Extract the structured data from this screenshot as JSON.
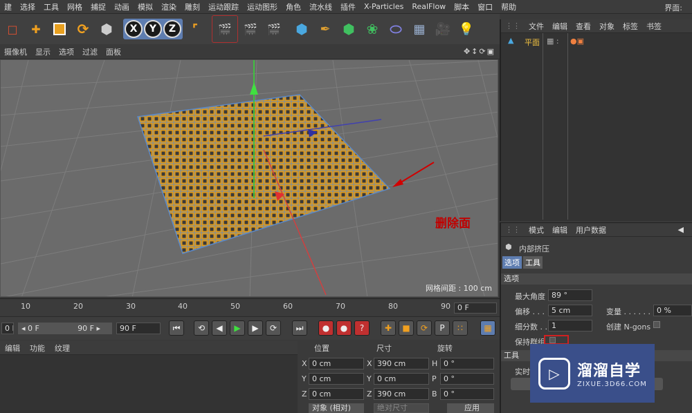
{
  "menu": {
    "items": [
      "建",
      "选择",
      "工具",
      "网格",
      "捕捉",
      "动画",
      "模拟",
      "渲染",
      "雕刻",
      "运动跟踪",
      "运动图形",
      "角色",
      "流水线",
      "插件",
      "X-Particles",
      "RealFlow",
      "脚本",
      "窗口",
      "帮助"
    ],
    "layout_label": "界面:"
  },
  "toolbar": {
    "axis_x": "X",
    "axis_y": "Y",
    "axis_z": "Z"
  },
  "viewport": {
    "menu": [
      "摄像机",
      "显示",
      "选项",
      "过滤",
      "面板"
    ],
    "grid_info": "网格间距 : 100 cm",
    "annotation": "删除面"
  },
  "timeline": {
    "ticks": [
      "10",
      "20",
      "30",
      "40",
      "50",
      "60",
      "70",
      "80",
      "90"
    ],
    "frame_value": "0 F"
  },
  "transport": {
    "start": "0 F",
    "range_start": "◂ 0 F",
    "range_end": "90 F ▸",
    "end": "90 F"
  },
  "material": {
    "tabs": [
      "编辑",
      "功能",
      "纹理"
    ]
  },
  "coords": {
    "headers": [
      "位置",
      "尺寸",
      "旋转"
    ],
    "rows": [
      {
        "p_label": "X",
        "p_val": "0 cm",
        "s_label": "X",
        "s_val": "390 cm",
        "r_label": "H",
        "r_val": "0 °"
      },
      {
        "p_label": "Y",
        "p_val": "0 cm",
        "s_label": "Y",
        "s_val": "0 cm",
        "r_label": "P",
        "r_val": "0 °"
      },
      {
        "p_label": "Z",
        "p_val": "0 cm",
        "s_label": "Z",
        "s_val": "390 cm",
        "r_label": "B",
        "r_val": "0 °"
      }
    ],
    "mode_select": "对象 (相对)",
    "size_select": "绝对尺寸",
    "apply_label": "应用"
  },
  "objects": {
    "menu": [
      "文件",
      "编辑",
      "查看",
      "对象",
      "标签",
      "书签"
    ],
    "items": [
      {
        "name": "平面"
      }
    ]
  },
  "attributes": {
    "menu": [
      "模式",
      "编辑",
      "用户数据"
    ],
    "tool_name": "内部挤压",
    "tabs": [
      "选项",
      "工具"
    ],
    "section_options": "选项",
    "max_angle_label": "最大角度",
    "max_angle_value": "89 °",
    "offset_label": "偏移 . . .",
    "offset_value": "5 cm",
    "variance_label": "变量 . . . . . . . .",
    "variance_value": "0 %",
    "subdiv_label": "细分数 . .",
    "subdiv_value": "1",
    "ngons_label": "创建 N-gons",
    "keep_groups_label": "保持群组",
    "section_tool": "工具",
    "realtime_label": "实时"
  },
  "watermark": {
    "title": "溜溜自学",
    "subtitle": "ZIXUE.3D66.COM"
  },
  "colors": {
    "accent": "#5e7db0",
    "mesh_orange": "#e09a1a",
    "annotation_red": "#c00000"
  }
}
